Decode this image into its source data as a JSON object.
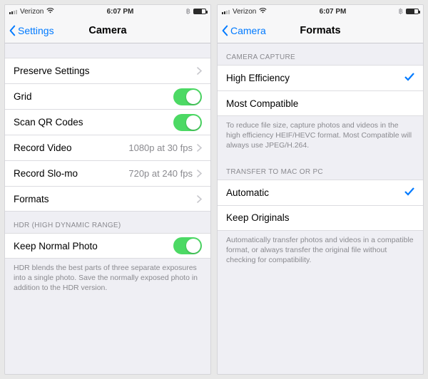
{
  "status": {
    "carrier": "Verizon",
    "time": "6:07 PM",
    "bluetooth": "฿"
  },
  "left": {
    "back": "Settings",
    "title": "Camera",
    "rows": {
      "preserve": "Preserve Settings",
      "grid": "Grid",
      "qr": "Scan QR Codes",
      "record_video": "Record Video",
      "record_video_val": "1080p at 30 fps",
      "record_slomo": "Record Slo-mo",
      "record_slomo_val": "720p at 240 fps",
      "formats": "Formats"
    },
    "hdr_header": "HDR (HIGH DYNAMIC RANGE)",
    "keep_normal": "Keep Normal Photo",
    "hdr_footer": "HDR blends the best parts of three separate exposures into a single photo. Save the normally exposed photo in addition to the HDR version."
  },
  "right": {
    "back": "Camera",
    "title": "Formats",
    "capture_header": "CAMERA CAPTURE",
    "high_eff": "High Efficiency",
    "most_compat": "Most Compatible",
    "capture_footer": "To reduce file size, capture photos and videos in the high efficiency HEIF/HEVC format. Most Compatible will always use JPEG/H.264.",
    "transfer_header": "TRANSFER TO MAC OR PC",
    "automatic": "Automatic",
    "keep_originals": "Keep Originals",
    "transfer_footer": "Automatically transfer photos and videos in a compatible format, or always transfer the original file without checking for compatibility."
  }
}
